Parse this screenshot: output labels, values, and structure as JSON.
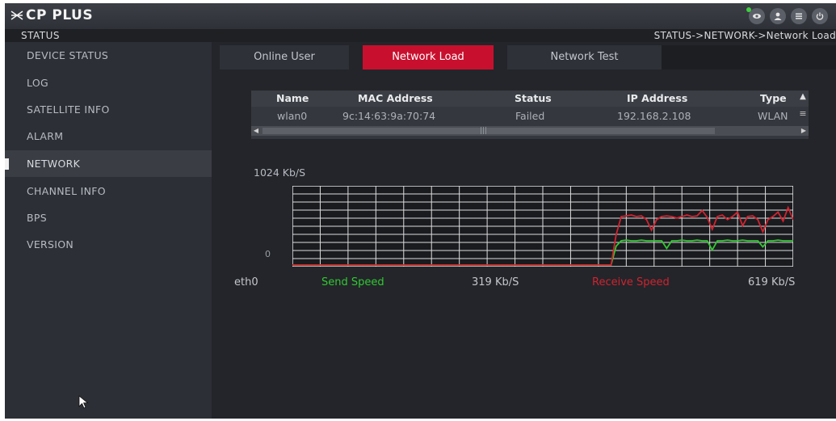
{
  "app": {
    "brand": "CP PLUS",
    "section_title": "STATUS",
    "breadcrumb": "STATUS->NETWORK->Network Load"
  },
  "top_icons": [
    "remote-view-icon",
    "user-icon",
    "menu-icon",
    "power-icon"
  ],
  "colors": {
    "accent_red": "#c8102e",
    "send_green": "#32c832",
    "receive_red": "#d0232f",
    "status_dot": "#3fcf3f"
  },
  "sidebar": {
    "items": [
      {
        "label": "DEVICE STATUS"
      },
      {
        "label": "LOG"
      },
      {
        "label": "SATELLITE INFO"
      },
      {
        "label": "ALARM"
      },
      {
        "label": "NETWORK",
        "active": true
      },
      {
        "label": "CHANNEL INFO"
      },
      {
        "label": "BPS"
      },
      {
        "label": "VERSION"
      }
    ]
  },
  "tabs": [
    {
      "label": "Online User"
    },
    {
      "label": "Network Load",
      "active": true
    },
    {
      "label": "Network Test"
    }
  ],
  "table": {
    "columns": [
      "Name",
      "MAC Address",
      "Status",
      "IP Address",
      "Type"
    ],
    "rows": [
      [
        "wlan0",
        "9c:14:63:9a:70:74",
        "Failed",
        "192.168.2.108",
        "WLAN"
      ]
    ]
  },
  "graph": {
    "max_label": "1024 Kb/S",
    "zero_label": "0"
  },
  "chart_data": {
    "type": "line",
    "ylim": [
      0,
      1024
    ],
    "y_unit": "Kb/S",
    "grid": true,
    "series": [
      {
        "name": "Send Speed",
        "color": "#32c832",
        "values": [
          0,
          0,
          0,
          0,
          0,
          0,
          0,
          0,
          0,
          0,
          0,
          0,
          0,
          0,
          0,
          0,
          0,
          0,
          0,
          0,
          0,
          0,
          0,
          0,
          0,
          0,
          0,
          0,
          0,
          0,
          0,
          0,
          0,
          0,
          0,
          0,
          0,
          0,
          0,
          0,
          0,
          0,
          0,
          0,
          0,
          0,
          0,
          0,
          0,
          0,
          0,
          0,
          0,
          0,
          0,
          0,
          0,
          0,
          0,
          0,
          0,
          0,
          0,
          0,
          250,
          320,
          330,
          320,
          320,
          330,
          320,
          320,
          320,
          320,
          220,
          320,
          320,
          330,
          320,
          320,
          330,
          320,
          320,
          200,
          320,
          320,
          330,
          320,
          320,
          330,
          320,
          320,
          320,
          240,
          320,
          320,
          330,
          320,
          320,
          320
        ]
      },
      {
        "name": "Receive Speed",
        "color": "#d0232f",
        "values": [
          0,
          0,
          0,
          0,
          0,
          0,
          0,
          0,
          0,
          0,
          0,
          0,
          0,
          0,
          0,
          0,
          0,
          0,
          0,
          0,
          0,
          0,
          0,
          0,
          0,
          0,
          0,
          0,
          0,
          0,
          0,
          0,
          0,
          0,
          0,
          0,
          0,
          0,
          0,
          0,
          0,
          0,
          0,
          0,
          0,
          0,
          0,
          0,
          0,
          0,
          0,
          0,
          0,
          0,
          0,
          0,
          0,
          0,
          0,
          0,
          0,
          0,
          0,
          0,
          400,
          640,
          650,
          660,
          640,
          650,
          600,
          460,
          600,
          640,
          650,
          640,
          620,
          640,
          660,
          640,
          650,
          720,
          630,
          470,
          640,
          660,
          600,
          640,
          700,
          520,
          640,
          650,
          600,
          440,
          600,
          640,
          700,
          580,
          760,
          600
        ]
      }
    ]
  },
  "legend": {
    "interface": "eth0",
    "send_label": "Send Speed",
    "send_value": "319 Kb/S",
    "receive_label": "Receive Speed",
    "receive_value": "619 Kb/S"
  }
}
